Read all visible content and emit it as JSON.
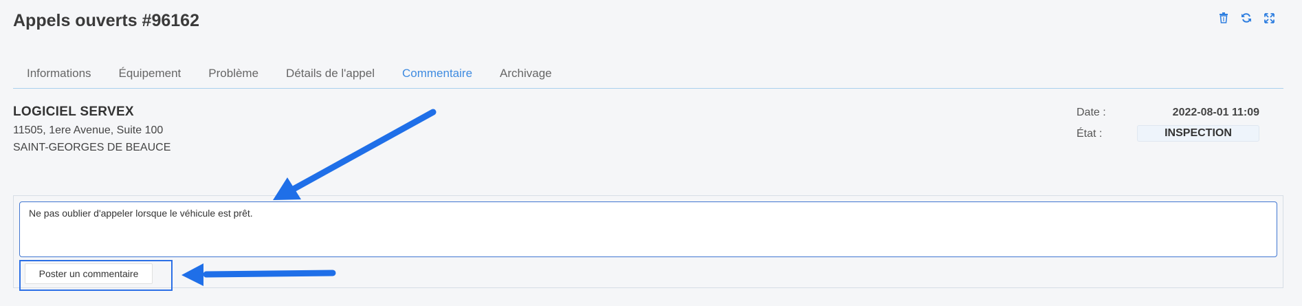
{
  "header": {
    "title": "Appels ouverts #96162",
    "actions": [
      {
        "name": "delete",
        "icon": "trash-icon"
      },
      {
        "name": "refresh",
        "icon": "refresh-icon"
      },
      {
        "name": "expand",
        "icon": "expand-icon"
      }
    ]
  },
  "tabs": [
    {
      "label": "Informations",
      "active": false
    },
    {
      "label": "Équipement",
      "active": false
    },
    {
      "label": "Problème",
      "active": false
    },
    {
      "label": "Détails de l'appel",
      "active": false
    },
    {
      "label": "Commentaire",
      "active": true
    },
    {
      "label": "Archivage",
      "active": false
    }
  ],
  "client": {
    "name": "LOGICIEL SERVEX",
    "address": "11505, 1ere Avenue, Suite 100",
    "city": "SAINT-GEORGES DE BEAUCE"
  },
  "meta": {
    "date_label": "Date :",
    "date_value": "2022-08-01 11:09",
    "state_label": "État :",
    "state_value": "INSPECTION"
  },
  "comment": {
    "value": "Ne pas oublier d'appeler lorsque le véhicule est prêt.",
    "post_label": "Poster un commentaire"
  },
  "colors": {
    "accent": "#3f8be0",
    "annotation": "#2b6fe6",
    "tab_border": "#a9d0ee"
  }
}
